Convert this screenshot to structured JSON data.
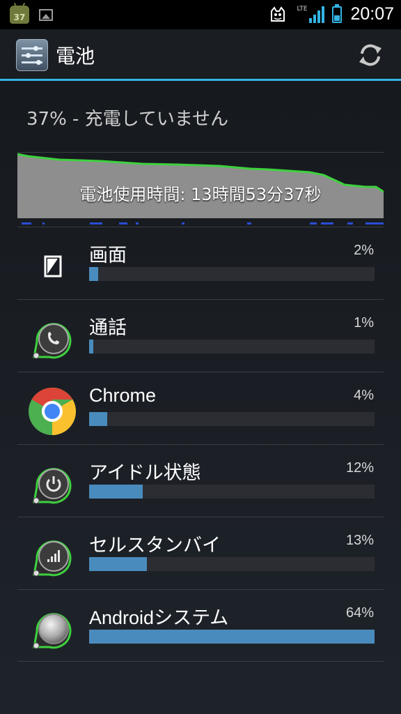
{
  "status_bar": {
    "notification_badge": "37",
    "network": "LTE",
    "time": "20:07",
    "battery_level": 0.37,
    "icons": [
      "android-notification-icon",
      "image-icon",
      "cat-icon",
      "signal-icon",
      "battery-icon"
    ]
  },
  "action_bar": {
    "title": "電池",
    "icons": [
      "settings-sliders-icon",
      "refresh-icon"
    ],
    "accent_color": "#33b5e5"
  },
  "summary": "37% - 充電していません",
  "graph": {
    "label": "電池使用時間: 13時間53分37秒",
    "line_color": "#3ed13e",
    "fill_color": "#8e8e8e"
  },
  "usage": [
    {
      "name": "画面",
      "percent_label": "2%",
      "value": 2,
      "icon": "screen-icon"
    },
    {
      "name": "通話",
      "percent_label": "1%",
      "value": 1,
      "icon": "phone-icon"
    },
    {
      "name": "Chrome",
      "percent_label": "4%",
      "value": 4,
      "icon": "chrome-icon"
    },
    {
      "name": "アイドル状態",
      "percent_label": "12%",
      "value": 12,
      "icon": "power-icon"
    },
    {
      "name": "セルスタンバイ",
      "percent_label": "13%",
      "value": 13,
      "icon": "cell-signal-icon"
    },
    {
      "name": "Androidシステム",
      "percent_label": "64%",
      "value": 64,
      "icon": "android-system-icon"
    }
  ],
  "bar_color": "#4a8bbd"
}
